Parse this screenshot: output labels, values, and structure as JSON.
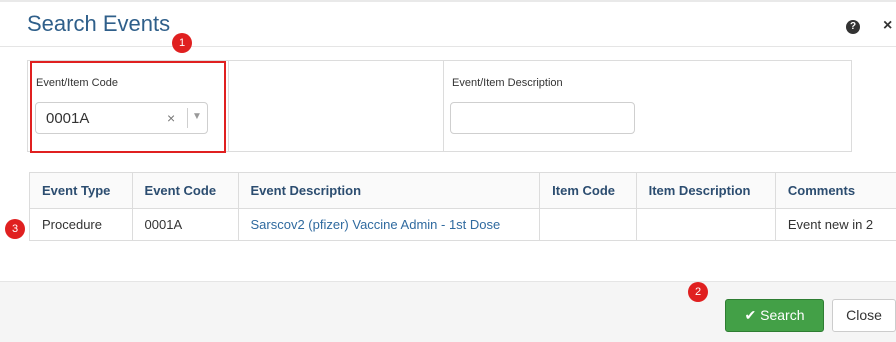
{
  "dialog": {
    "title": "Search Events",
    "help_icon": "?",
    "close_icon": "×"
  },
  "annotations": [
    "1",
    "2",
    "3"
  ],
  "filter": {
    "code_label": "Event/Item Code",
    "code_value": "0001A",
    "clear_icon": "×",
    "dropdown_icon": "▼",
    "desc_label": "Event/Item Description",
    "desc_value": ""
  },
  "table": {
    "headers": [
      "Event Type",
      "Event Code",
      "Event Description",
      "Item Code",
      "Item Description",
      "Comments"
    ],
    "rows": [
      [
        "Procedure",
        "0001A",
        "Sarscov2 (pfizer) Vaccine Admin - 1st Dose",
        "",
        "",
        "Event new in 2"
      ]
    ]
  },
  "footer": {
    "search_label": "Search",
    "search_icon": "✔",
    "close_label": "Close"
  },
  "colors": {
    "title": "#2f5f8a",
    "annotation_red": "#e02020",
    "search_green": "#43a047"
  }
}
